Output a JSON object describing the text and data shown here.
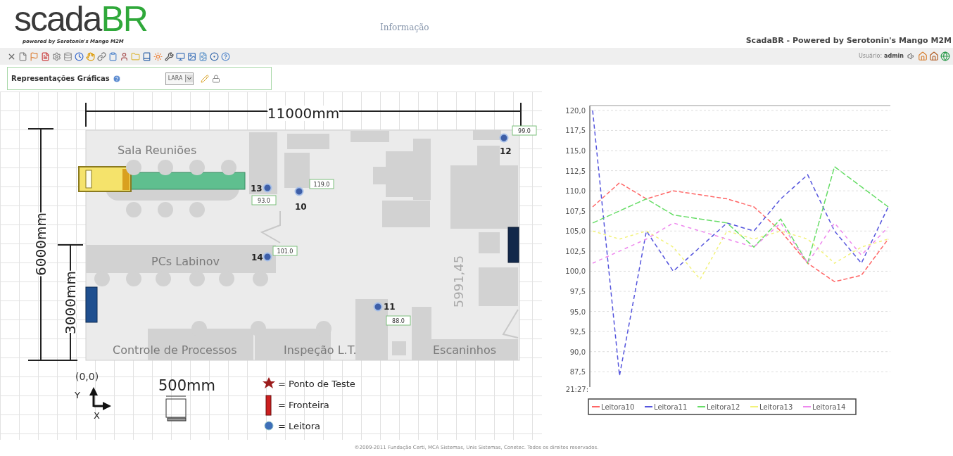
{
  "header": {
    "logo_main": "scada",
    "logo_accent": "BR",
    "logo_tagline": "powered by Serotonin's Mango M2M",
    "info_link": "Informação",
    "product_title": "ScadaBR - Powered by Serotonin's Mango M2M"
  },
  "user_bar": {
    "label": "Usuário:",
    "user": "admin"
  },
  "view_panel": {
    "title": "Representações Gráficas",
    "view_select": "LARA"
  },
  "floor_plan": {
    "width_dimension": "11000mm",
    "height_dimension": "6000mm",
    "partial_dimension": "3000mm",
    "inner_dimension": "5991,45",
    "rooms": [
      {
        "name": "Sala Reuniões"
      },
      {
        "name": "PCs Labinov"
      },
      {
        "name": "Controle de Processos"
      },
      {
        "name": "Inspeção L.T."
      },
      {
        "name": "Escaninhos"
      }
    ],
    "readers": [
      {
        "number": "13",
        "value": "93.0"
      },
      {
        "number": "10",
        "value": "119.0"
      },
      {
        "number": "12",
        "value": "99.0"
      },
      {
        "number": "14",
        "value": "101.0"
      },
      {
        "number": "11",
        "value": "88.0"
      }
    ],
    "legend": {
      "origin": "(0,0)",
      "y_axis": "Y",
      "x_axis": "X",
      "scale": "500mm",
      "items": [
        {
          "kind": "test-point",
          "label": "= Ponto de Teste"
        },
        {
          "kind": "boundary",
          "label": "= Fronteira"
        },
        {
          "kind": "reader",
          "label": "= Leitora"
        }
      ]
    }
  },
  "chart": {
    "x_tick_label": "21:27:",
    "chart_data": {
      "type": "line",
      "grid": true,
      "legend": true,
      "ylim": [
        85.6,
        120.6
      ],
      "yticks": [
        {
          "value": 87.5,
          "label": "87,5"
        },
        {
          "value": 90,
          "label": "90,0"
        },
        {
          "value": 92.5,
          "label": "92,5"
        },
        {
          "value": 95,
          "label": "95,0"
        },
        {
          "value": 97.5,
          "label": "97,5"
        },
        {
          "value": 100,
          "label": "100,0"
        },
        {
          "value": 102.5,
          "label": "102,5"
        },
        {
          "value": 105,
          "label": "105,0"
        },
        {
          "value": 107.5,
          "label": "107,5"
        },
        {
          "value": 110,
          "label": "110,0"
        },
        {
          "value": 112.5,
          "label": "112,5"
        },
        {
          "value": 115,
          "label": "115,0"
        },
        {
          "value": 117.5,
          "label": "117,5"
        },
        {
          "value": 120,
          "label": "120,0"
        }
      ],
      "series": [
        {
          "name": "Leitora10",
          "color": "#ff6666",
          "line_style": "dashed",
          "values": [
            108,
            111,
            109,
            110,
            109.5,
            109,
            108,
            105,
            101,
            98.7,
            99.5,
            104
          ]
        },
        {
          "name": "Leitora11",
          "color": "#5555dd",
          "line_style": "dashed",
          "values": [
            120,
            87,
            105,
            100,
            103,
            106,
            105,
            109,
            112,
            105,
            101,
            108
          ]
        },
        {
          "name": "Leitora12",
          "color": "#66dd66",
          "line_style": "dashed",
          "values": [
            106,
            107.5,
            109,
            107,
            106.5,
            106,
            103,
            106.5,
            101,
            113,
            110.5,
            108
          ]
        },
        {
          "name": "Leitora13",
          "color": "#f2f27a",
          "line_style": "dashed",
          "values": [
            105,
            104,
            105,
            103,
            99,
            105,
            104,
            105,
            104,
            101,
            103,
            104
          ]
        },
        {
          "name": "Leitora14",
          "color": "#ee88ee",
          "line_style": "dashed",
          "values": [
            101,
            102.5,
            104,
            106,
            105,
            104,
            103,
            106,
            101,
            106,
            102,
            105.5
          ]
        }
      ]
    }
  },
  "footer": "©2009-2011 Fundação Certi, MCA Sistemas, Unis Sistemas, Conetec. Todos os direitos reservados."
}
